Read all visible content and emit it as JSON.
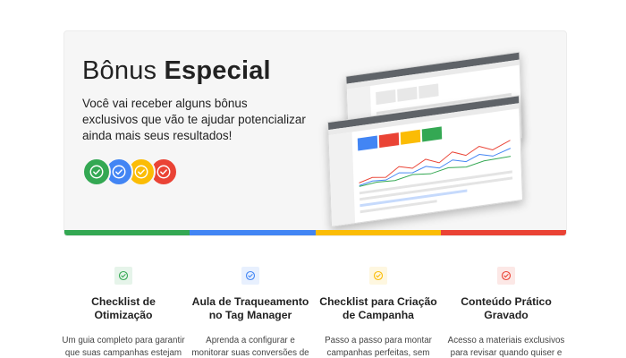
{
  "hero": {
    "title_prefix": "Bônus",
    "title_bold": "Especial",
    "subtitle": "Você vai receber alguns bônus exclusivos que vão te ajudar potencializar ainda mais seus resultados!",
    "badges": [
      {
        "icon": "check-circle-icon",
        "color": "#34a853"
      },
      {
        "icon": "check-circle-icon",
        "color": "#4285f4"
      },
      {
        "icon": "check-circle-icon",
        "color": "#fbbc05"
      },
      {
        "icon": "check-circle-icon",
        "color": "#ea4335"
      }
    ],
    "stripe_colors": [
      "#34a853",
      "#4285f4",
      "#fbbc05",
      "#ea4335"
    ]
  },
  "features": [
    {
      "title": "Checklist de Otimização",
      "description": "Um guia completo para garantir que suas campanhas estejam sempre maximizadas",
      "icon": "check-circle-icon",
      "icon_bg": "#e6f4ea",
      "icon_color": "#34a853"
    },
    {
      "title": "Aula de Traqueamento no Tag Manager",
      "description": "Aprenda a configurar e monitorar suas conversões de forma eficiente",
      "icon": "check-circle-icon",
      "icon_bg": "#e8f0fe",
      "icon_color": "#4285f4"
    },
    {
      "title": "Checklist para Criação de Campanha",
      "description": "Passo a passo para montar campanhas perfeitas, sem esquecer de nenhum detalhe",
      "icon": "check-circle-icon",
      "icon_bg": "#fef7e0",
      "icon_color": "#fbbc05"
    },
    {
      "title": "Conteúdo Prático Gravado",
      "description": "Acesso a materiais exclusivos para revisar quando quiser e consolidar seus aprendizados",
      "icon": "check-circle-icon",
      "icon_bg": "#fce8e6",
      "icon_color": "#ea4335"
    }
  ]
}
